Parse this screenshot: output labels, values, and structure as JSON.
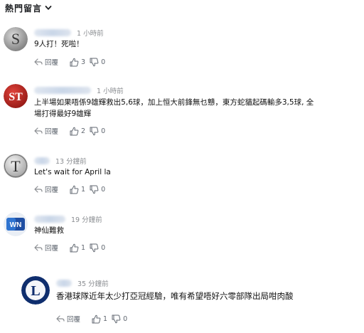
{
  "header": {
    "title": "熱門留言"
  },
  "comments": [
    {
      "avatar_letter": "S",
      "time": "1 小時前",
      "text": "9人打！死啦！",
      "reply_label": "回覆",
      "likes": "3",
      "dislikes": "0",
      "avatar_style": "silver-s"
    },
    {
      "avatar_letter": "ST",
      "time": "1 小時前",
      "text": "上半場如果唔係9雄輝救出5,6球，加上恒大前鋒無乜戇，東方蛇貓起碼輸多3,5球, 全\n場打得最好9雄輝",
      "reply_label": "回覆",
      "likes": "2",
      "dislikes": "0",
      "avatar_style": "red-st"
    },
    {
      "avatar_letter": "T",
      "time": "13 分鐘前",
      "text": "Let's wait for April la",
      "reply_label": "回覆",
      "likes": "1",
      "dislikes": "0",
      "avatar_style": "grey-t"
    },
    {
      "avatar_letter": "WN",
      "time": "19 分鐘前",
      "text": "神仙難救",
      "reply_label": "回覆",
      "likes": "1",
      "dislikes": "0",
      "avatar_style": "blue-wn"
    },
    {
      "avatar_letter": "L",
      "time": "35 分鐘前",
      "text": "香港球隊近年太少打亞冠經驗，唯有希望唔好六零部隊出局咁肉酸",
      "reply_label": "回覆",
      "likes": "1",
      "dislikes": "0",
      "avatar_style": "navy-l"
    }
  ]
}
